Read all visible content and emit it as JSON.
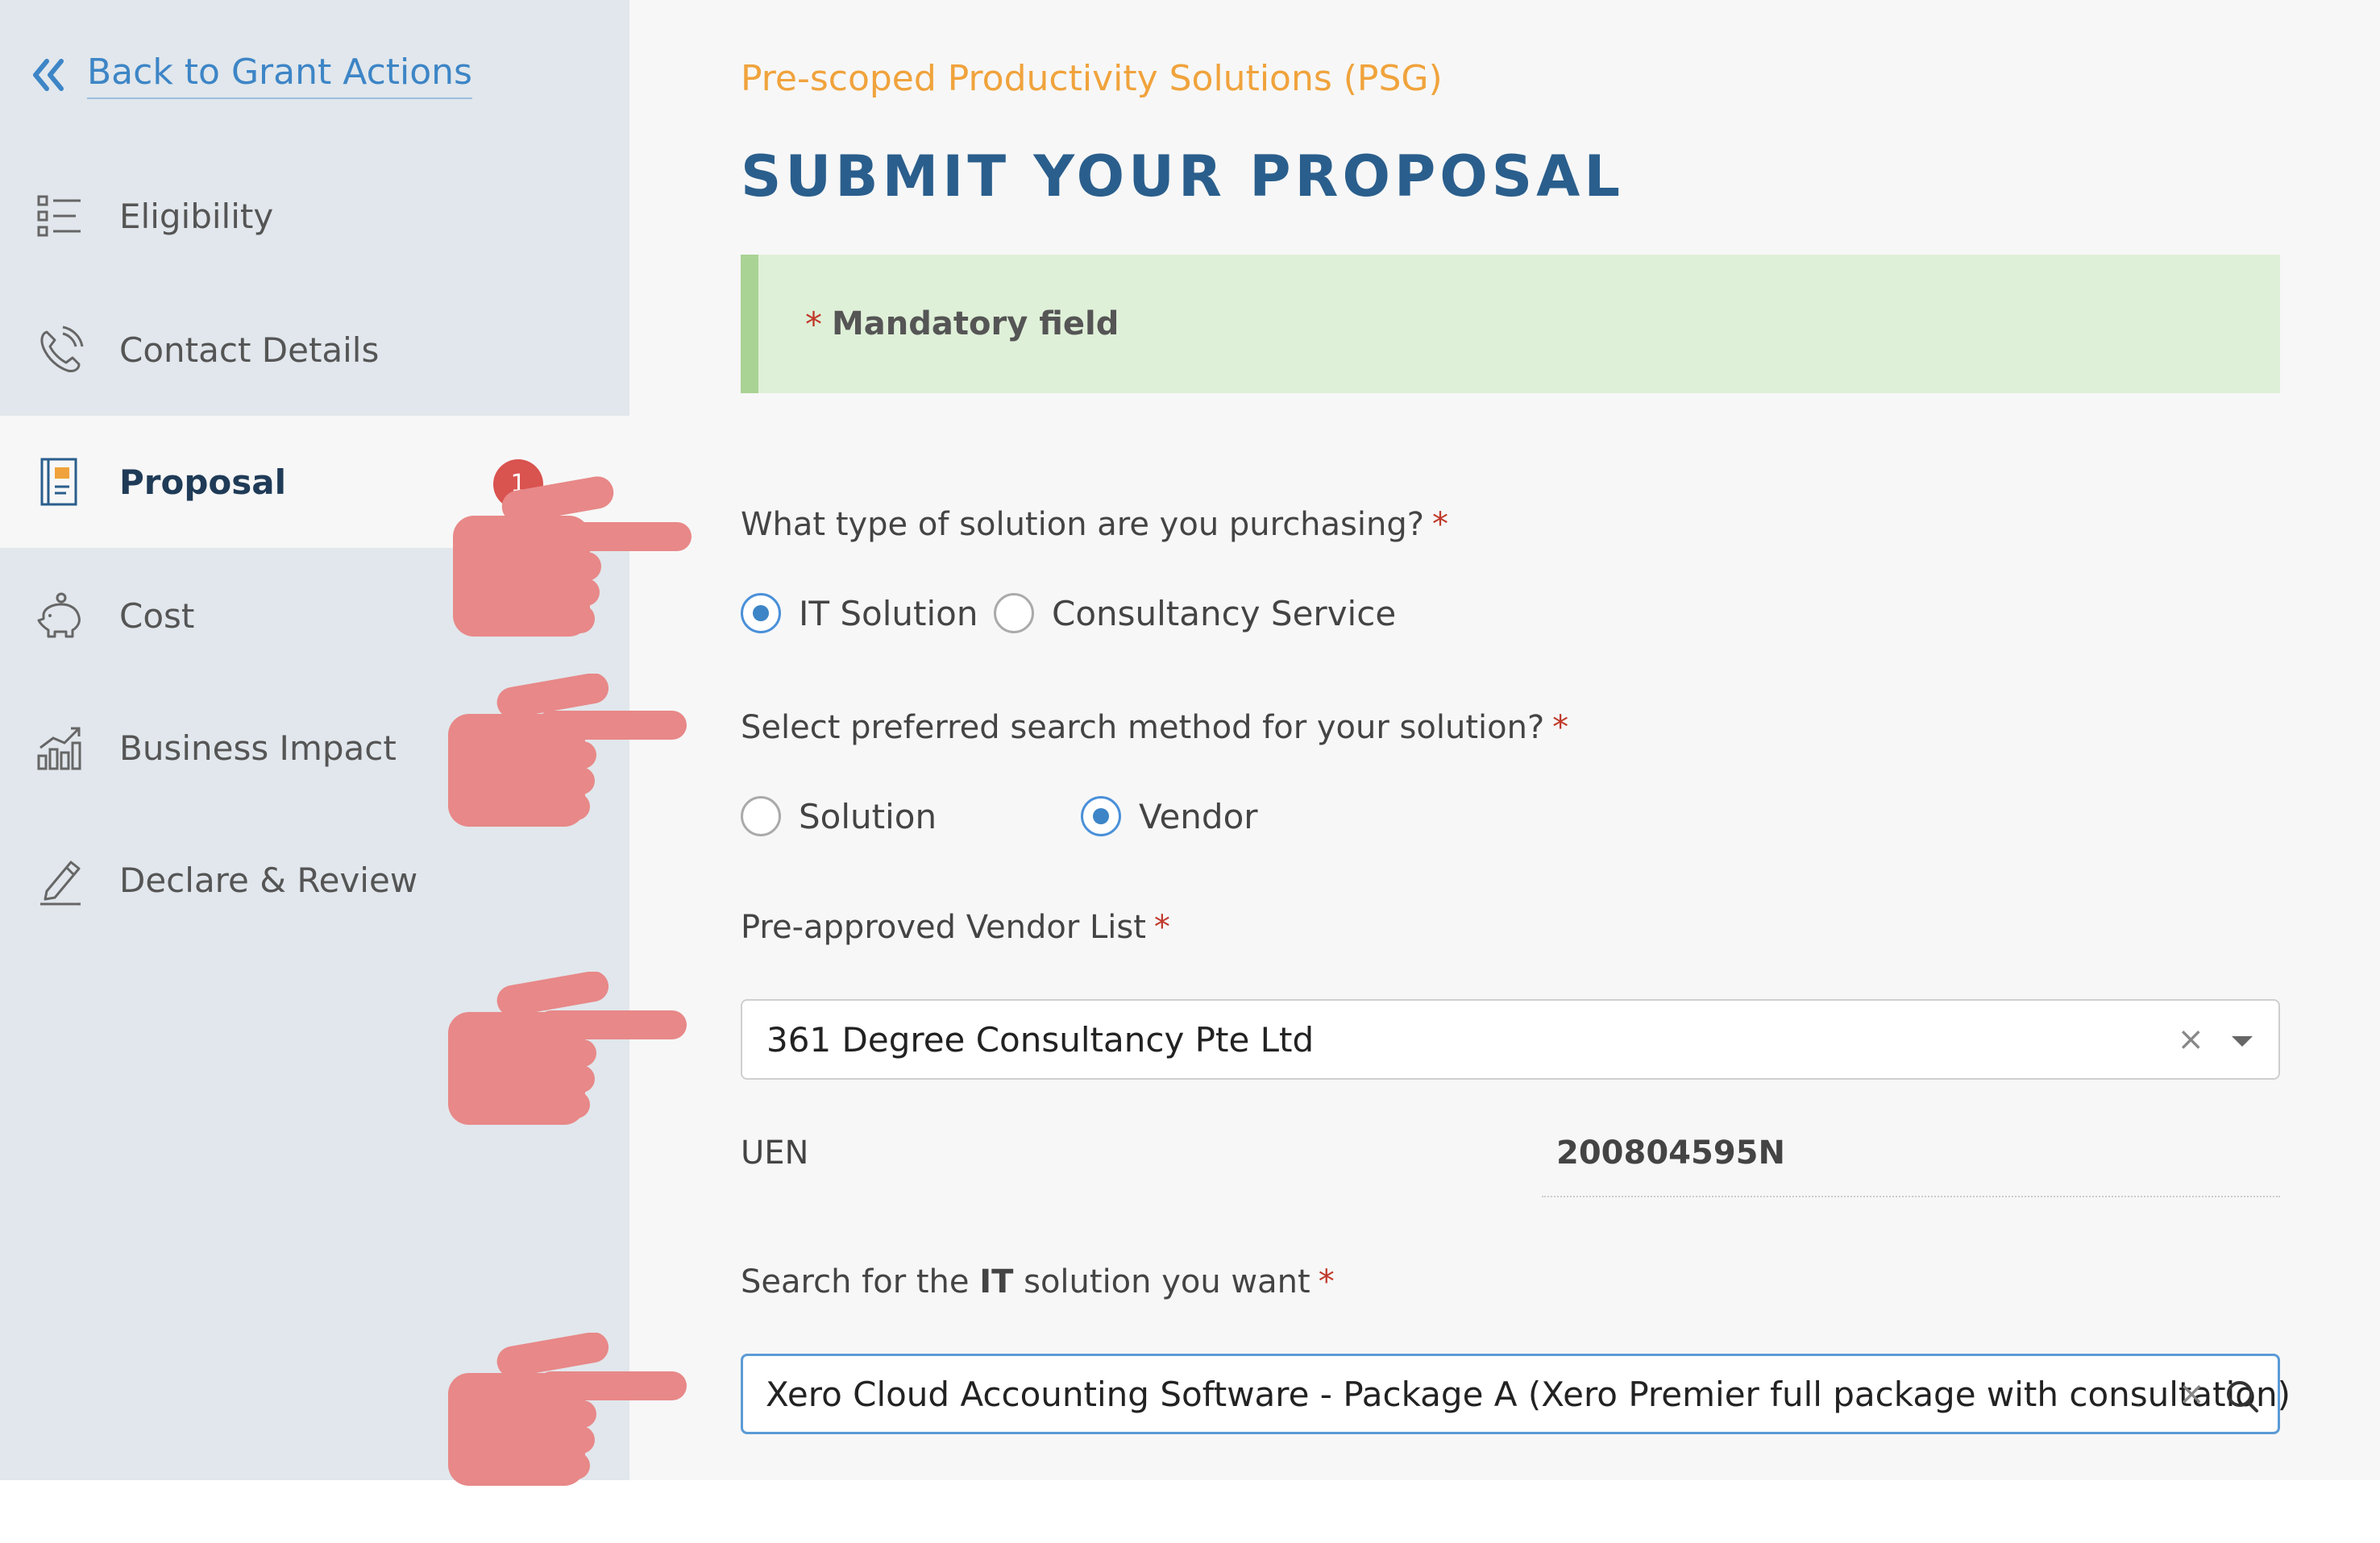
{
  "sidebar": {
    "back_label": "Back to Grant Actions",
    "items": [
      {
        "label": "Eligibility",
        "icon": "checklist-icon"
      },
      {
        "label": "Contact Details",
        "icon": "phone-icon"
      },
      {
        "label": "Proposal",
        "icon": "notebook-icon",
        "badge": "1",
        "active": true
      },
      {
        "label": "Cost",
        "icon": "piggy-bank-icon"
      },
      {
        "label": "Business Impact",
        "icon": "bar-chart-icon"
      },
      {
        "label": "Declare & Review",
        "icon": "pen-icon"
      }
    ]
  },
  "main": {
    "subtitle": "Pre-scoped Productivity Solutions (PSG)",
    "title": "SUBMIT YOUR PROPOSAL",
    "notice": {
      "star": "*",
      "text": "Mandatory field"
    },
    "q1": {
      "label": "What type of solution are you purchasing?",
      "required": "*",
      "options": [
        "IT Solution",
        "Consultancy Service"
      ],
      "selected": "IT Solution"
    },
    "q2": {
      "label": "Select preferred search method for your solution?",
      "required": "*",
      "options": [
        "Solution",
        "Vendor"
      ],
      "selected": "Vendor"
    },
    "vendor": {
      "label": "Pre-approved Vendor List",
      "required": "*",
      "value": "361 Degree Consultancy Pte Ltd",
      "clear": "×"
    },
    "uen": {
      "label": "UEN",
      "value": "200804595N"
    },
    "search": {
      "label_prefix": "Search for the ",
      "label_bold": "IT",
      "label_suffix": " solution you want",
      "required": "*",
      "value": "Xero Cloud Accounting Software - Package A (Xero Premier full package with consultation)",
      "clear": "×"
    }
  },
  "colors": {
    "sidebar_bg": "#e1e7ec",
    "accent_blue": "#3d85c6",
    "title_blue": "#2a5e8c",
    "subtitle_orange": "#f0a33c",
    "notice_bg": "#dff0d8",
    "badge_red": "#d9534f",
    "hand_pink": "#e88888"
  }
}
